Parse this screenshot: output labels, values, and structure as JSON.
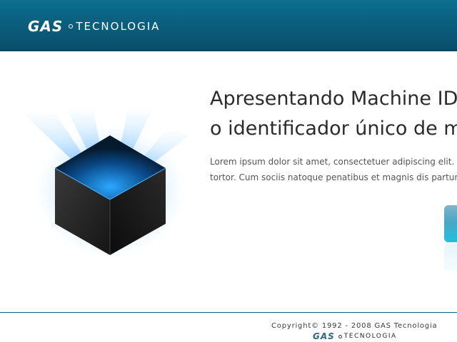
{
  "header": {
    "logo_brand": "GAS",
    "logo_suffix": "TECNOLOGIA"
  },
  "hero": {
    "title_line1": "Apresentando Machine ID",
    "title_line2": "o identificador único de m",
    "body_line1": "Lorem ipsum dolor sit amet, consectetuer adipiscing elit. Ae",
    "body_line2": "tortor. Cum sociis natoque penatibus et magnis dis parturien",
    "graphic_icon": "glowing-cube-icon"
  },
  "footer": {
    "copyright": "Copyright© 1992 - 2008 GAS Tecnologia",
    "logo_brand": "GAS",
    "logo_suffix": "TECNOLOGIA"
  },
  "colors": {
    "header_bg": "#0a5f7e",
    "accent": "#22bfe0",
    "glow": "#1e90ff"
  }
}
